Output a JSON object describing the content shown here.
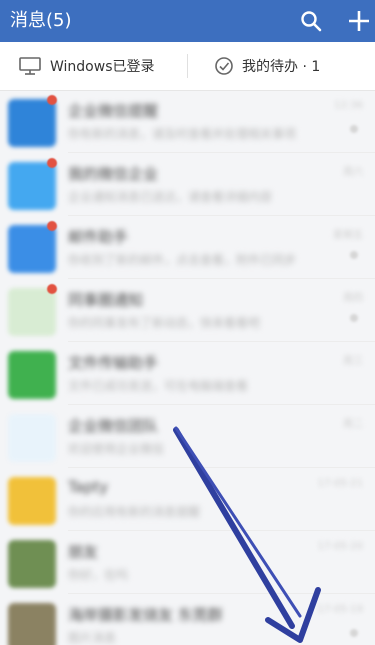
{
  "header": {
    "title": "消息(5)",
    "bg": "#3d6fbf",
    "icons": [
      "search-icon",
      "plus-icon"
    ]
  },
  "subbar": {
    "windows_label": "Windows已登录",
    "todo_label": "我的待办 · 1"
  },
  "messages": [
    {
      "title": "企业微信提醒",
      "preview": "你有新的消息，请及时查看并处理相关事项",
      "time": "12:36",
      "avatar": "#2f84d9",
      "badge": true
    },
    {
      "title": "我的微信企业",
      "preview": "企业通知消息已送达，请查看详细内容",
      "time": "周六",
      "avatar": "#44a8f0",
      "badge": true
    },
    {
      "title": "邮件助手",
      "preview": "你收到了新的邮件，点击查看，附件已同步",
      "time": "星期五",
      "avatar": "#3b8ee6",
      "badge": true
    },
    {
      "title": "同事圈通知",
      "preview": "你的同事发布了新动态，快来看看吧",
      "time": "周四",
      "avatar": "#d8ecd3",
      "badge": true
    },
    {
      "title": "文件传输助手",
      "preview": "文件已成功发送，可在电脑端查看",
      "time": "周三",
      "avatar": "#40b14f",
      "badge": false
    },
    {
      "title": "企业微信团队",
      "preview": "欢迎使用企业微信",
      "time": "周二",
      "avatar": "#e8f3fb",
      "badge": false
    },
    {
      "title": "Tapty",
      "preview": "你的应用有新的消息提醒",
      "time": "17-05-21",
      "avatar": "#f1c13a",
      "badge": false
    },
    {
      "title": "朋友",
      "preview": "你好，在吗",
      "time": "17-05-20",
      "avatar": "#6f8f53",
      "badge": false
    },
    {
      "title": "海岸摄影发烧友 东莞群",
      "preview": "图片消息",
      "time": "17-05-19",
      "avatar": "#8b8262",
      "badge": false
    }
  ]
}
